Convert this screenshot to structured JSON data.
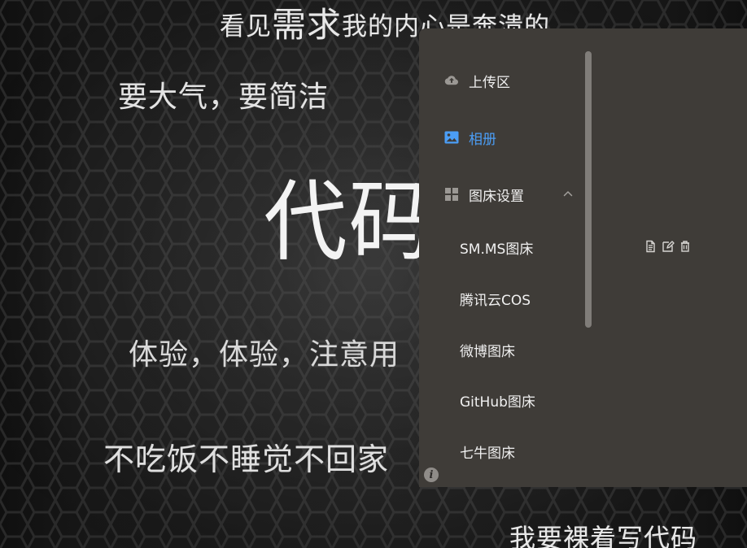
{
  "background_texts": {
    "line1_prefix": "看见",
    "line1_accent": "需求",
    "line1_suffix": "我的内心是奔溃的",
    "line2": "要大气，要简洁",
    "line3": "代码",
    "line4": "体验，体验，注意用",
    "line5": "不吃饭不睡觉不回家",
    "line6": "我要裸着写代码"
  },
  "menu": {
    "items": [
      {
        "label": "上传区",
        "icon": "cloud-upload-icon"
      },
      {
        "label": "相册",
        "icon": "image-icon",
        "active": true
      },
      {
        "label": "图床设置",
        "icon": "grid-icon",
        "expanded": true
      },
      {
        "label": "SM.MS图床"
      },
      {
        "label": "腾讯云COS"
      },
      {
        "label": "微博图床"
      },
      {
        "label": "GitHub图床"
      },
      {
        "label": "七牛图床"
      }
    ]
  },
  "actions": {
    "icons": [
      "document-icon",
      "edit-icon",
      "trash-icon"
    ]
  },
  "colors": {
    "panel": "#3f3c38",
    "active": "#4b9ef6",
    "text": "#f0f0f0",
    "icon": "#9b9894",
    "scrollbar": "#807d79"
  }
}
